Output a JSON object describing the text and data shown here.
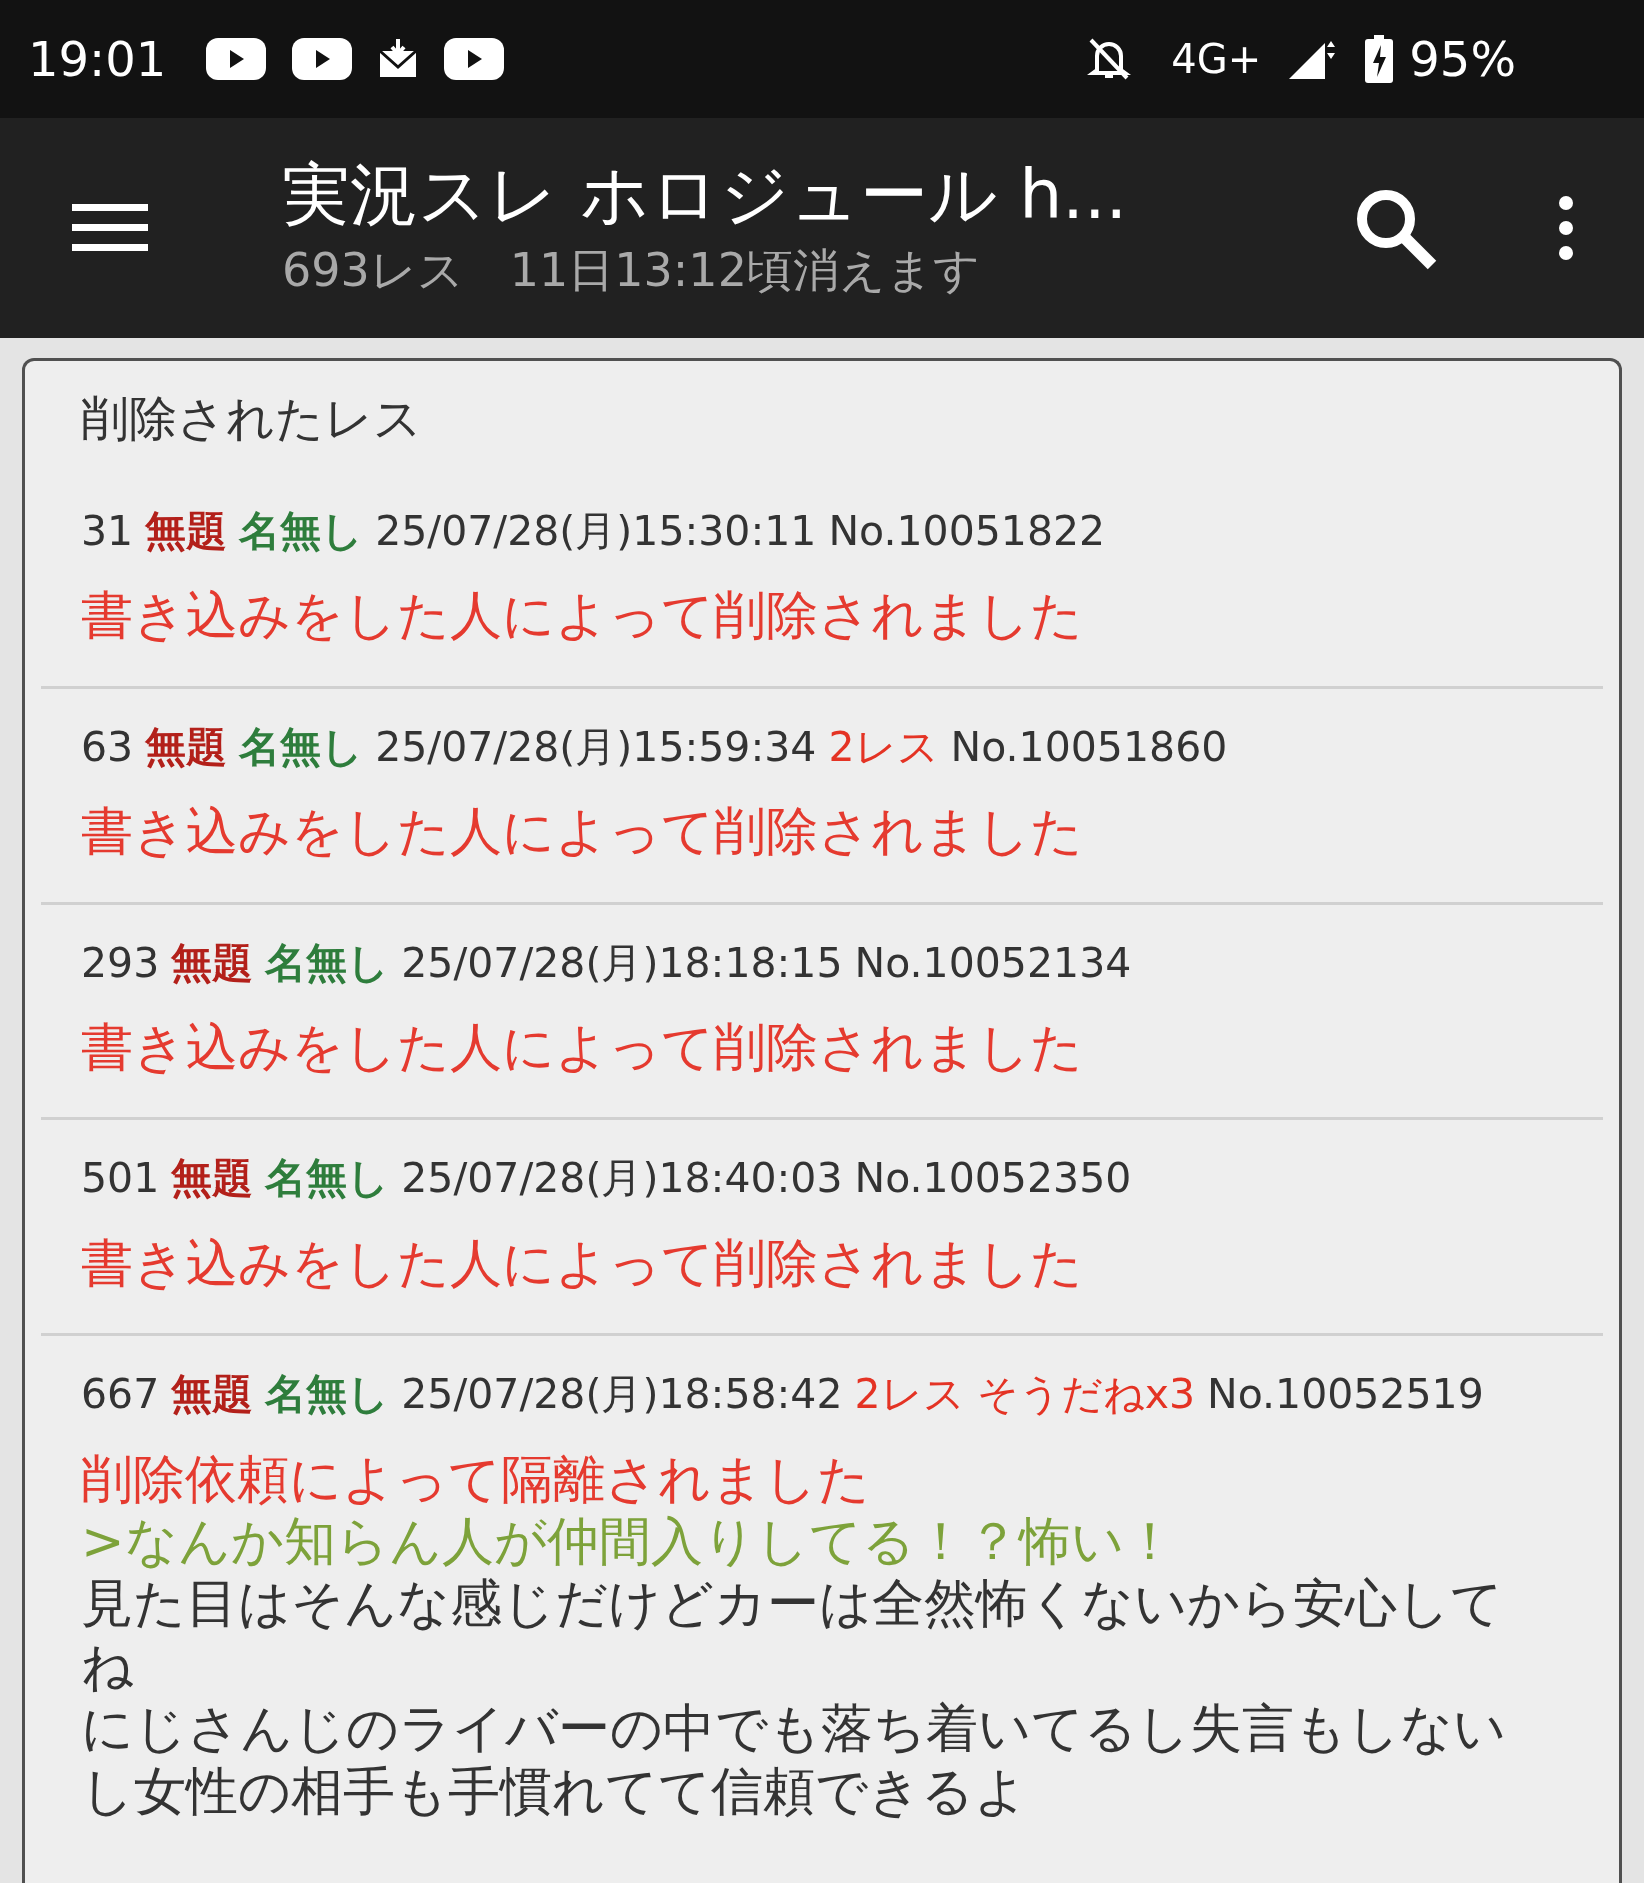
{
  "status_bar": {
    "time": "19:01",
    "notification_icons": [
      {
        "kind": "video"
      },
      {
        "kind": "video"
      },
      {
        "kind": "mail"
      },
      {
        "kind": "video"
      }
    ],
    "network": "4G+",
    "battery": "95%"
  },
  "app_bar": {
    "title": "実況スレ ホロジュール h...",
    "subtitle": "693レス　11日13:12頃消えます"
  },
  "dialog": {
    "title": "削除されたレス",
    "posts": [
      {
        "header": [
          {
            "kind": "number",
            "text": "31"
          },
          {
            "kind": "subject",
            "text": "無題"
          },
          {
            "kind": "name",
            "text": "名無し"
          },
          {
            "kind": "date",
            "text": "25/07/28(月)15:30:11"
          },
          {
            "kind": "no",
            "text": "No.10051822"
          }
        ],
        "body": [
          {
            "kind": "deleted",
            "text": "書き込みをした人によって削除されました"
          }
        ]
      },
      {
        "header": [
          {
            "kind": "number",
            "text": "63"
          },
          {
            "kind": "subject",
            "text": "無題"
          },
          {
            "kind": "name",
            "text": "名無し"
          },
          {
            "kind": "date",
            "text": "25/07/28(月)15:59:34"
          },
          {
            "kind": "replies",
            "text": "2レス"
          },
          {
            "kind": "no",
            "text": "No.10051860"
          }
        ],
        "body": [
          {
            "kind": "deleted",
            "text": "書き込みをした人によって削除されました"
          }
        ]
      },
      {
        "header": [
          {
            "kind": "number",
            "text": "293"
          },
          {
            "kind": "subject",
            "text": "無題"
          },
          {
            "kind": "name",
            "text": "名無し"
          },
          {
            "kind": "date",
            "text": "25/07/28(月)18:18:15"
          },
          {
            "kind": "no",
            "text": "No.10052134"
          }
        ],
        "body": [
          {
            "kind": "deleted",
            "text": "書き込みをした人によって削除されました"
          }
        ]
      },
      {
        "header": [
          {
            "kind": "number",
            "text": "501"
          },
          {
            "kind": "subject",
            "text": "無題"
          },
          {
            "kind": "name",
            "text": "名無し"
          },
          {
            "kind": "date",
            "text": "25/07/28(月)18:40:03"
          },
          {
            "kind": "no",
            "text": "No.10052350"
          }
        ],
        "body": [
          {
            "kind": "deleted",
            "text": "書き込みをした人によって削除されました"
          }
        ]
      },
      {
        "header": [
          {
            "kind": "number",
            "text": "667"
          },
          {
            "kind": "subject",
            "text": "無題"
          },
          {
            "kind": "name",
            "text": "名無し"
          },
          {
            "kind": "date",
            "text": "25/07/28(月)18:58:42"
          },
          {
            "kind": "replies",
            "text": "2レス"
          },
          {
            "kind": "sodane",
            "text": "そうだねx3"
          },
          {
            "kind": "no",
            "text": "No.10052519"
          }
        ],
        "body": [
          {
            "kind": "deleted",
            "text": "削除依頼によって隔離されました"
          },
          {
            "kind": "quote",
            "text": ">なんか知らん人が仲間入りしてる！？怖い！"
          },
          {
            "kind": "text",
            "text": "見た目はそんな感じだけどカーは全然怖くないから安心してね"
          },
          {
            "kind": "text",
            "text": "にじさんじのライバーの中でも落ち着いてるし失言もしないし女性の相手も手慣れてて信頼できるよ"
          }
        ]
      }
    ]
  }
}
